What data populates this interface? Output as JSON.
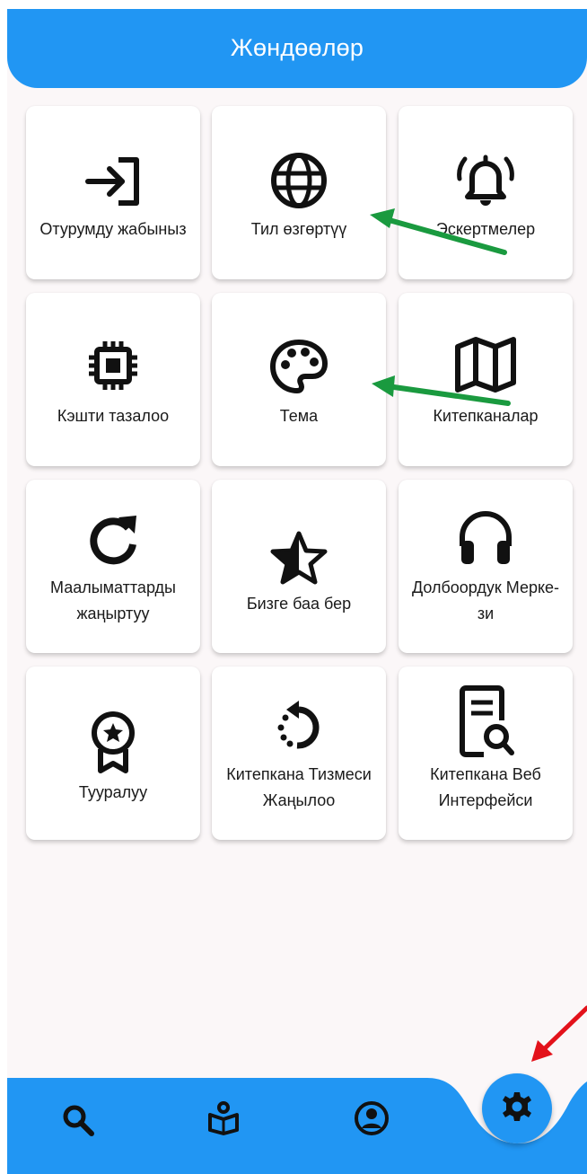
{
  "header": {
    "title": "Жөндөөлөр"
  },
  "tiles": [
    {
      "label": "Отурумду жабыныз",
      "icon": "logout-icon"
    },
    {
      "label": "Тил өзгөртүү",
      "icon": "globe-icon"
    },
    {
      "label": "Эскертмелер",
      "icon": "bell-ringing-icon"
    },
    {
      "label": "Кэшти тазалоо",
      "icon": "chip-icon"
    },
    {
      "label": "Тема",
      "icon": "palette-icon"
    },
    {
      "label": "Китепканалар",
      "icon": "map-icon"
    },
    {
      "label": "Маалыматтарды жаңыртуу",
      "icon": "refresh-icon"
    },
    {
      "label": "Бизге баа бер",
      "icon": "star-half-icon"
    },
    {
      "label": "Долбоордук Мерке-\nзи",
      "icon": "headphones-icon"
    },
    {
      "label": "Тууралуу",
      "icon": "award-icon"
    },
    {
      "label": "Китепкана Тизмеси Жаңылоо",
      "icon": "rotate-dotted-icon"
    },
    {
      "label": "Китепкана Веб Интерфейси",
      "icon": "document-search-icon"
    }
  ],
  "bottom_nav": {
    "items": [
      {
        "icon": "search-icon"
      },
      {
        "icon": "reader-icon"
      },
      {
        "icon": "account-circle-icon"
      }
    ],
    "active": {
      "icon": "settings-gear-icon"
    }
  },
  "colors": {
    "primary": "#2196f3",
    "annotation_green": "#1a9a3f",
    "annotation_red": "#e3121b"
  }
}
